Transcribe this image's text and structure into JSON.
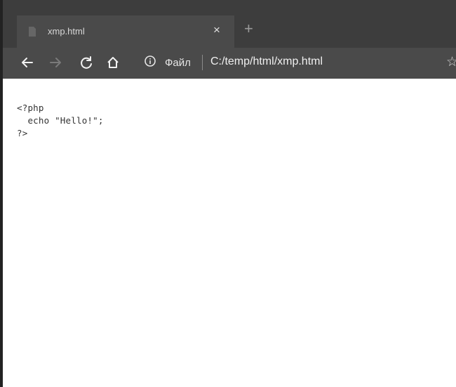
{
  "browser": {
    "tab": {
      "title": "xmp.html",
      "close_glyph": "×",
      "favicon_icon": "page-icon"
    },
    "new_tab_glyph": "+",
    "toolbar": {
      "back_icon": "arrow-left-icon",
      "forward_icon": "arrow-right-icon",
      "reload_icon": "reload-icon",
      "home_icon": "home-icon",
      "info_icon": "info-icon",
      "scheme_label": "Файл",
      "address": "C:/temp/html/xmp.html",
      "bookmark_glyph": "☆"
    },
    "colors": {
      "chrome_dark": "#3d3d3d",
      "toolbar": "#4a4a4a",
      "page_bg": "#ffffff"
    }
  },
  "page": {
    "code_lines": [
      "<?php",
      "  echo \"Hello!\";",
      "?>"
    ]
  }
}
